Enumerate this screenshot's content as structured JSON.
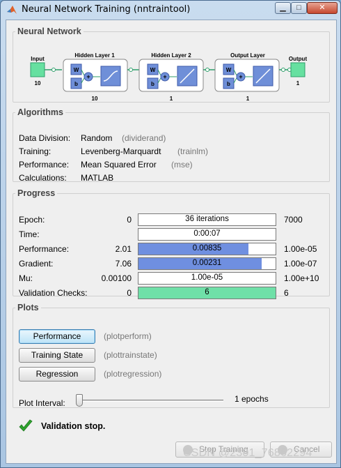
{
  "window": {
    "title": "Neural Network Training (nntraintool)",
    "controls": {
      "minimize": "▁",
      "maximize": "□",
      "close": "✕"
    }
  },
  "neural_network": {
    "legend": "Neural Network",
    "input": {
      "label": "Input",
      "count": "10"
    },
    "layers": [
      {
        "label": "Hidden Layer 1",
        "size": "10",
        "transfer": "sigmoid"
      },
      {
        "label": "Hidden Layer 2",
        "size": "1",
        "transfer": "linear"
      },
      {
        "label": "Output Layer",
        "size": "1",
        "transfer": "linear"
      }
    ],
    "output": {
      "label": "Output",
      "count": "1"
    },
    "weight_label": "W",
    "bias_label": "b",
    "sum_symbol": "+"
  },
  "algorithms": {
    "legend": "Algorithms",
    "rows": [
      {
        "label": "Data Division:",
        "value": "Random",
        "fn": "(dividerand)"
      },
      {
        "label": "Training:",
        "value": "Levenberg-Marquardt",
        "fn": "(trainlm)"
      },
      {
        "label": "Performance:",
        "value": "Mean Squared Error",
        "fn": "(mse)"
      },
      {
        "label": "Calculations:",
        "value": "MATLAB",
        "fn": ""
      }
    ]
  },
  "progress": {
    "legend": "Progress",
    "rows": [
      {
        "label": "Epoch:",
        "min": "0",
        "text": "36 iterations",
        "max": "7000",
        "fill": 0.0,
        "fill_color": "#6f8fe0"
      },
      {
        "label": "Time:",
        "min": "",
        "text": "0:00:07",
        "max": "",
        "fill": 0.0,
        "fill_color": "#6f8fe0"
      },
      {
        "label": "Performance:",
        "min": "2.01",
        "text": "0.00835",
        "max": "1.00e-05",
        "fill": 0.8,
        "fill_color": "#6f8fe0"
      },
      {
        "label": "Gradient:",
        "min": "7.06",
        "text": "0.00231",
        "max": "1.00e-07",
        "fill": 0.9,
        "fill_color": "#6f8fe0"
      },
      {
        "label": "Mu:",
        "min": "0.00100",
        "text": "1.00e-05",
        "max": "1.00e+10",
        "fill": 0.0,
        "fill_color": "#6f8fe0"
      },
      {
        "label": "Validation Checks:",
        "min": "0",
        "text": "6",
        "max": "6",
        "fill": 1.0,
        "fill_color": "#6fe0a8"
      }
    ]
  },
  "plots": {
    "legend": "Plots",
    "buttons": [
      {
        "label": "Performance",
        "fn": "(plotperform)"
      },
      {
        "label": "Training State",
        "fn": "(plottrainstate)"
      },
      {
        "label": "Regression",
        "fn": "(plotregression)"
      }
    ],
    "interval_label": "Plot Interval:",
    "interval_value": "1 epochs",
    "interval_level": 0.0
  },
  "status": {
    "icon": "checkmark-icon",
    "text": "Validation stop.",
    "color": "#2ea32e"
  },
  "footer": {
    "stop_label": "Stop Training",
    "cancel_label": "Cancel"
  },
  "watermark": "CSDN @2301_76862294",
  "colors": {
    "node_green": "#66e0a0",
    "weight_blue": "#6f8fd8",
    "connector_green": "#2e9e6a"
  }
}
